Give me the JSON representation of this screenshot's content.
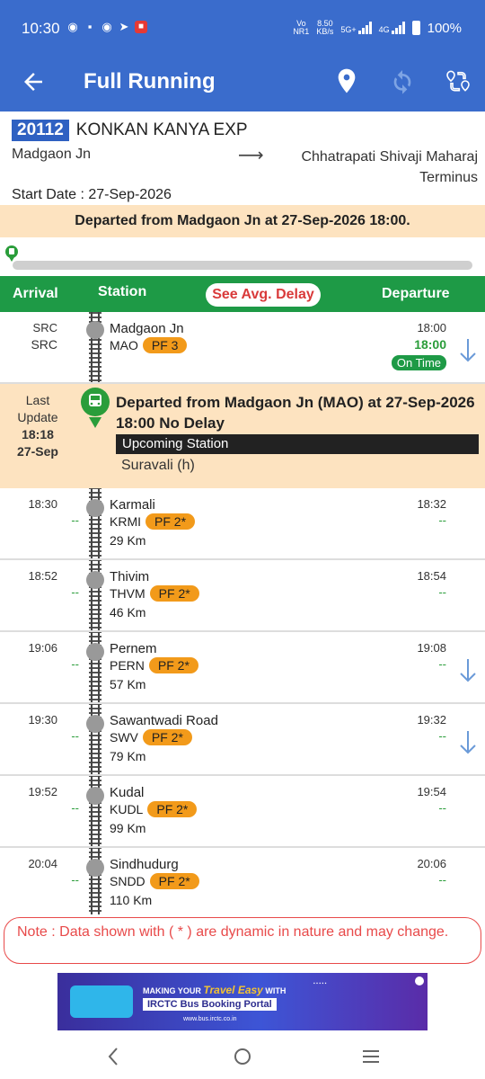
{
  "status_bar": {
    "time": "10:30",
    "carrier": "Vo\nNR1",
    "speed": "8.50\nKB/s",
    "net1": "5G+",
    "net2": "4G",
    "battery": "100%"
  },
  "app_bar": {
    "title": "Full Running"
  },
  "train": {
    "number": "20112",
    "name": "KONKAN KANYA EXP",
    "from": "Madgaon Jn",
    "to": "Chhatrapati Shivaji Maharaj Terminus",
    "start_date": "Start Date : 27-Sep-2026",
    "status_banner": "Departed from Madgaon Jn at 27-Sep-2026 18:00."
  },
  "table_header": {
    "arrival": "Arrival",
    "station": "Station",
    "avg_delay": "See Avg. Delay",
    "departure": "Departure"
  },
  "source_row": {
    "arr_top": "SRC",
    "arr_bottom": "SRC",
    "station": "Madgaon Jn",
    "code": "MAO",
    "pf": "PF 3",
    "dep_sched": "18:00",
    "dep_actual": "18:00",
    "dep_status": "On Time"
  },
  "last_update": {
    "label": "Last Update",
    "time": "18:18",
    "date": "27-Sep",
    "message": "Departed from Madgaon Jn (MAO) at 27-Sep-2026 18:00 No Delay",
    "upcoming_label": "Upcoming Station",
    "upcoming_station": "Suravali (h)"
  },
  "stations": [
    {
      "arr": "18:30",
      "arr_delay": "--",
      "name": "Karmali",
      "code": "KRMI",
      "pf": "PF 2*",
      "km": "29 Km",
      "dep": "18:32",
      "dep_delay": "--"
    },
    {
      "arr": "18:52",
      "arr_delay": "--",
      "name": "Thivim",
      "code": "THVM",
      "pf": "PF 2*",
      "km": "46 Km",
      "dep": "18:54",
      "dep_delay": "--"
    },
    {
      "arr": "19:06",
      "arr_delay": "--",
      "name": "Pernem",
      "code": "PERN",
      "pf": "PF 2*",
      "km": "57 Km",
      "dep": "19:08",
      "dep_delay": "--"
    },
    {
      "arr": "19:30",
      "arr_delay": "--",
      "name": "Sawantwadi Road",
      "code": "SWV",
      "pf": "PF 2*",
      "km": "79 Km",
      "dep": "19:32",
      "dep_delay": "--"
    },
    {
      "arr": "19:52",
      "arr_delay": "--",
      "name": "Kudal",
      "code": "KUDL",
      "pf": "PF 2*",
      "km": "99 Km",
      "dep": "19:54",
      "dep_delay": "--"
    },
    {
      "arr": "20:04",
      "arr_delay": "--",
      "name": "Sindhudurg",
      "code": "SNDD",
      "pf": "PF 2*",
      "km": "110 Km",
      "dep": "20:06",
      "dep_delay": "--"
    }
  ],
  "note": "Note : Data shown with ( * ) are dynamic in nature and may change.",
  "ad": {
    "line1_prefix": "MAKING YOUR",
    "line1_em": "Travel Easy",
    "line1_suffix": "WITH",
    "line2": "IRCTC Bus Booking Portal",
    "line3": "www.bus.irctc.co.in"
  },
  "colors": {
    "primary": "#3a6ccc",
    "green": "#1e9a46",
    "highlight": "#fde3c0",
    "pf_badge": "#f29a1a",
    "note_red": "#e84a4a"
  }
}
